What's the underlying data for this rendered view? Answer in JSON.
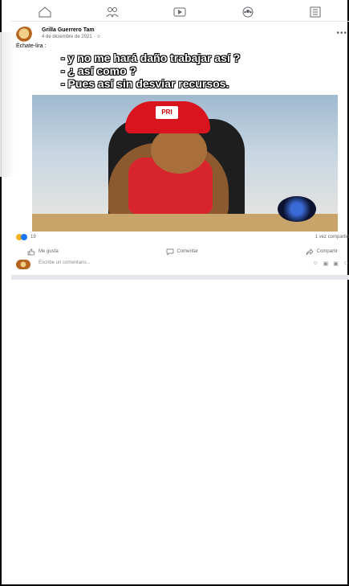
{
  "nav": {
    "items": [
      {
        "name": "home",
        "icon": "home-icon"
      },
      {
        "name": "friends",
        "icon": "friends-icon"
      },
      {
        "name": "watch",
        "icon": "video-icon"
      },
      {
        "name": "groups",
        "icon": "groups-icon"
      },
      {
        "name": "menu",
        "icon": "menu-icon"
      }
    ]
  },
  "post": {
    "author": "Grilla Guerrero Tam",
    "meta": "4 de diciembre de 2021 · ☺",
    "more_label": "•••",
    "text": "Échate-lira :",
    "captions": [
      "- y no me hará daño trabajar así ?",
      "- ¿ así como  ?",
      "- Pues así sin desviar recursos."
    ],
    "image_logo": "PRI",
    "reaction_count": "19",
    "shares": "1 vez compartid",
    "actions": {
      "like": "Me gusta",
      "comment": "Comentar",
      "share": "Compartir"
    },
    "comment_placeholder": "Escribe un comentario..."
  },
  "colors": {
    "accent": "#1877f2",
    "text_secondary": "#65676b"
  }
}
